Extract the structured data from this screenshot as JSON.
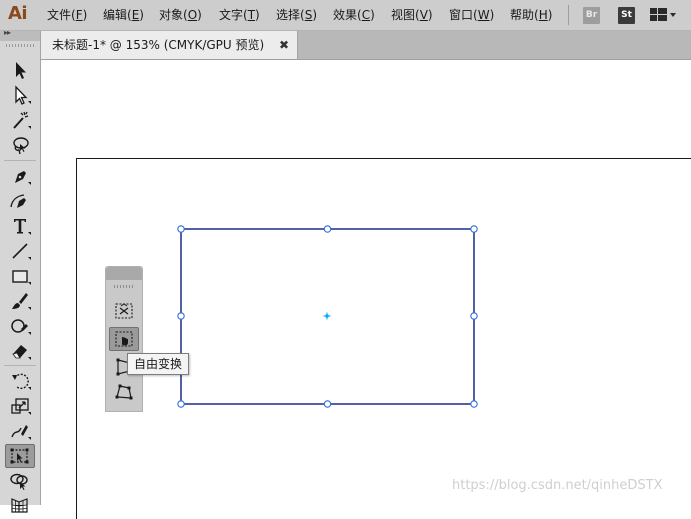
{
  "app": {
    "logo": "Ai"
  },
  "menu": {
    "items": [
      {
        "label": "文件(",
        "key": "F",
        "end": ")"
      },
      {
        "label": "编辑(",
        "key": "E",
        "end": ")"
      },
      {
        "label": "对象(",
        "key": "O",
        "end": ")"
      },
      {
        "label": "文字(",
        "key": "T",
        "end": ")"
      },
      {
        "label": "选择(",
        "key": "S",
        "end": ")"
      },
      {
        "label": "效果(",
        "key": "C",
        "end": ")"
      },
      {
        "label": "视图(",
        "key": "V",
        "end": ")"
      },
      {
        "label": "窗口(",
        "key": "W",
        "end": ")"
      },
      {
        "label": "帮助(",
        "key": "H",
        "end": ")"
      }
    ],
    "badges": {
      "bridge": "Br",
      "stock": "St"
    }
  },
  "document": {
    "tab_title": "未标题-1* @ 153% (CMYK/GPU 预览)",
    "close_glyph": "✖"
  },
  "tooltip": {
    "text": "自由变换"
  },
  "watermark": {
    "text": "https://blog.csdn.net/qinheDSTX"
  },
  "colors": {
    "selection_stroke": "#1b2a8a",
    "handle_stroke": "#2f6fd8",
    "center_point": "#00a8ff",
    "logo": "#8a4a1c"
  },
  "toolbar": {
    "tools": [
      "selection-tool",
      "direct-selection-tool",
      "magic-wand-tool",
      "lasso-tool",
      "pen-tool",
      "curvature-tool",
      "type-tool",
      "line-tool",
      "rectangle-tool",
      "paintbrush-tool",
      "shaper-tool",
      "eraser-tool",
      "rotate-tool",
      "scale-tool",
      "warp-tool",
      "free-transform-tool",
      "shape-builder-tool",
      "perspective-grid-tool"
    ],
    "active": "free-transform-tool"
  },
  "widget": {
    "tools": [
      "constrain-tool",
      "free-transform-tool",
      "perspective-distort-tool",
      "free-distort-tool"
    ],
    "active": "free-transform-tool"
  }
}
